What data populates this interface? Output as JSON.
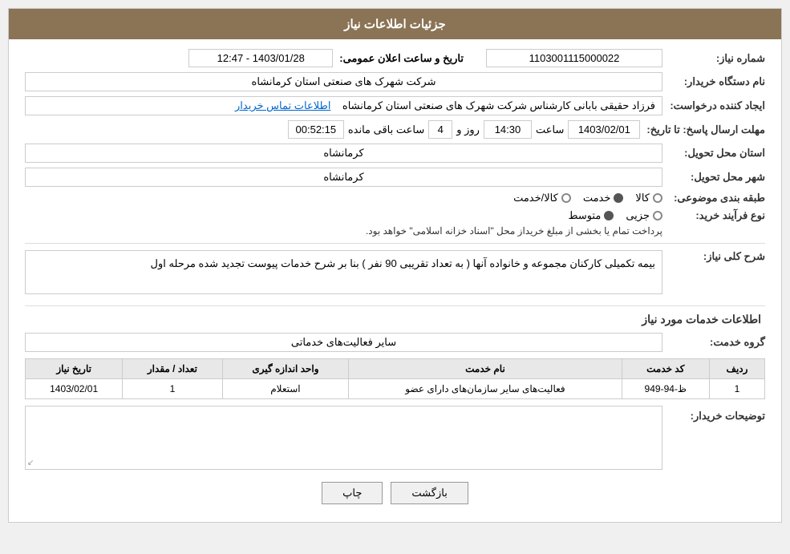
{
  "header": {
    "title": "جزئیات اطلاعات نیاز"
  },
  "fields": {
    "need_number_label": "شماره نیاز:",
    "need_number_value": "1103001115000022",
    "buyer_org_label": "نام دستگاه خریدار:",
    "buyer_org_value": "شرکت شهرک های صنعتی استان کرمانشاه",
    "creator_label": "ایجاد کننده درخواست:",
    "creator_value": "فرزاد حقیقی بابانی کارشناس شرکت شهرک های صنعتی استان کرمانشاه",
    "contact_link": "اطلاعات تماس خریدار",
    "deadline_label": "مهلت ارسال پاسخ: تا تاریخ:",
    "deadline_date": "1403/02/01",
    "deadline_time_label": "ساعت",
    "deadline_time": "14:30",
    "deadline_days_label": "روز و",
    "deadline_days": "4",
    "deadline_remaining_label": "ساعت باقی مانده",
    "deadline_remaining": "00:52:15",
    "announce_label": "تاریخ و ساعت اعلان عمومی:",
    "announce_value": "1403/01/28 - 12:47",
    "province_label": "استان محل تحویل:",
    "province_value": "کرمانشاه",
    "city_label": "شهر محل تحویل:",
    "city_value": "کرمانشاه",
    "category_label": "طبقه بندی موضوعی:",
    "category_options": [
      {
        "id": "kala",
        "label": "کالا",
        "selected": false
      },
      {
        "id": "khedmat",
        "label": "خدمت",
        "selected": true
      },
      {
        "id": "kala_khedmat",
        "label": "کالا/خدمت",
        "selected": false
      }
    ],
    "process_label": "نوع فرآیند خرید:",
    "process_options": [
      {
        "id": "jozvi",
        "label": "جزیی",
        "selected": false
      },
      {
        "id": "motovaset",
        "label": "متوسط",
        "selected": true
      }
    ],
    "process_note": "پرداخت تمام یا بخشی از مبلغ خریداز محل \"اسناد خزانه اسلامی\" خواهد بود.",
    "description_label": "شرح کلی نیاز:",
    "description_value": "بیمه تکمیلی کارکنان مجموعه و خانواده آنها ( به تعداد تقریبی 90 نفر ) بنا بر شرح خدمات پیوست تجدید شده مرحله اول",
    "services_section_title": "اطلاعات خدمات مورد نیاز",
    "service_group_label": "گروه خدمت:",
    "service_group_value": "سایر فعالیت‌های خدماتی",
    "table": {
      "headers": [
        "ردیف",
        "کد خدمت",
        "نام خدمت",
        "واحد اندازه گیری",
        "تعداد / مقدار",
        "تاریخ نیاز"
      ],
      "rows": [
        {
          "row_num": "1",
          "service_code": "ظ-94-949",
          "service_name": "فعالیت‌های سایر سازمان‌های دارای عضو",
          "unit": "استعلام",
          "quantity": "1",
          "date": "1403/02/01"
        }
      ]
    },
    "buyer_notes_label": "توضیحات خریدار:"
  },
  "buttons": {
    "print_label": "چاپ",
    "back_label": "بازگشت"
  }
}
